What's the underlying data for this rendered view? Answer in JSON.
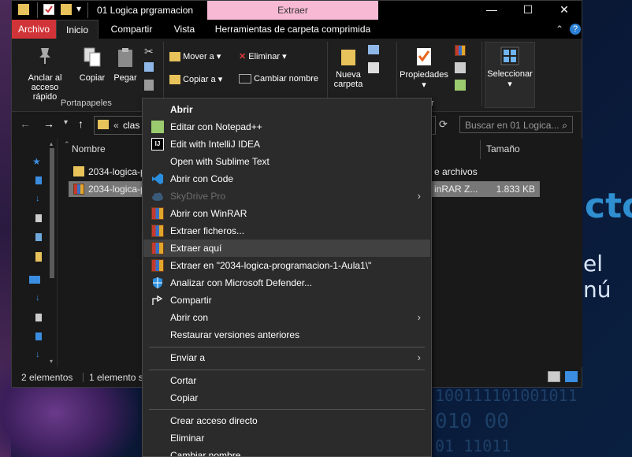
{
  "desktop": {
    "big_text": "cto",
    "sub_text": "el nú",
    "binary_1": "011101",
    "binary_2": "100111101001011",
    "binary_3": "010 00",
    "binary_4": "01 11011"
  },
  "window": {
    "title": "01 Logica prgramacion",
    "context_tab": "Extraer",
    "controls": {
      "minimize": "—",
      "maximize": "☐",
      "close": "✕"
    }
  },
  "tabs": {
    "archivo": "Archivo",
    "inicio": "Inicio",
    "compartir": "Compartir",
    "vista": "Vista",
    "herramientas": "Herramientas de carpeta comprimida",
    "help_icon": "?"
  },
  "ribbon": {
    "anclar_1": "Anclar al",
    "anclar_2": "acceso rápido",
    "copiar": "Copiar",
    "pegar": "Pegar",
    "mover_a": "Mover a",
    "copiar_a": "Copiar a",
    "eliminar": "Eliminar",
    "cambiar_nombre": "Cambiar nombre",
    "nueva_1": "Nueva",
    "nueva_2": "carpeta",
    "propiedades": "Propiedades",
    "seleccionar": "Seleccionar",
    "group_portapapeles": "Portapapeles",
    "group_abrir": "brir"
  },
  "address": {
    "path_prefix": "«",
    "path": "clas",
    "search_placeholder": "Buscar en 01 Logica..."
  },
  "columns": {
    "name": "Nombre",
    "size": "Tamaño"
  },
  "files": [
    {
      "name": "2034-logica-p",
      "type": "e archivos",
      "size": ""
    },
    {
      "name": "2034-logica-p",
      "type": "inRAR Z...",
      "size": "1.833 KB"
    }
  ],
  "status": {
    "count": "2 elementos",
    "selected": "1 elemento s"
  },
  "context_menu": {
    "abrir": "Abrir",
    "notepad": "Editar con Notepad++",
    "intellij": "Edit with IntelliJ IDEA",
    "sublime": "Open with Sublime Text",
    "vscode": "Abrir con Code",
    "skydrive": "SkyDrive Pro",
    "winrar_open": "Abrir con WinRAR",
    "extraer_ficheros": "Extraer ficheros...",
    "extraer_aqui": "Extraer aquí",
    "extraer_en": "Extraer en \"2034-logica-programacion-1-Aula1\\\"",
    "defender": "Analizar con Microsoft Defender...",
    "compartir": "Compartir",
    "abrir_con": "Abrir con",
    "restaurar": "Restaurar versiones anteriores",
    "enviar_a": "Enviar a",
    "cortar": "Cortar",
    "copiar": "Copiar",
    "crear_acceso": "Crear acceso directo",
    "eliminar": "Eliminar",
    "cambiar_nombre": "Cambiar nombre"
  },
  "colors": {
    "archivo_tab": "#d13438",
    "extraer_tab": "#f7b9d4",
    "menu_bg": "#2b2b2b",
    "menu_highlight": "#414141"
  }
}
